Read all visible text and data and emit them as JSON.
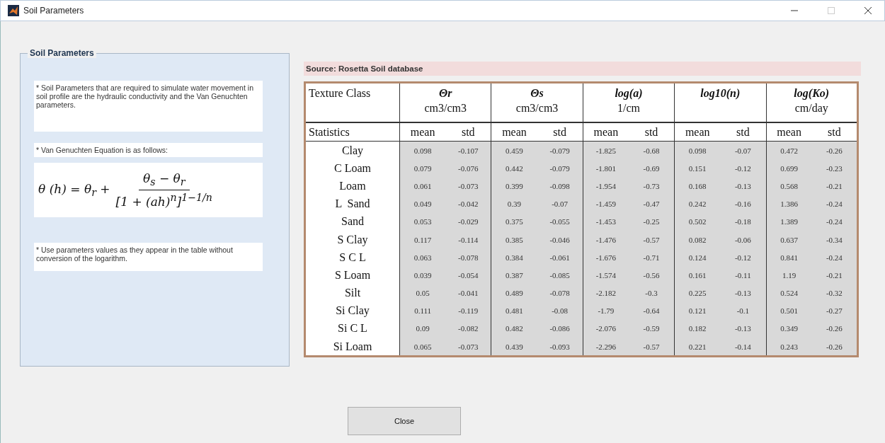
{
  "window": {
    "title": "Soil Parameters"
  },
  "panel": {
    "title": "Soil Parameters",
    "items": [
      {
        "kind": "note",
        "text": "* Soil Parameters that are required to simulate water movement in soil profile are the hydraulic conductivity and the Van Genuchten parameters."
      },
      {
        "kind": "note",
        "text": "* Van Genuchten Equation is as follows:"
      },
      {
        "kind": "equation",
        "lhs": "θ (h) = θ$_{r}$ +",
        "numerator": "θ$_{s}$ − θ$_{r}$",
        "denominator": "[1 + (ah)$^{n}$]$^{1−1/n}$"
      },
      {
        "kind": "note",
        "text": "* Use parameters values as they appear in the table without conversion of the logarithm."
      }
    ]
  },
  "source": "Source: Rosetta Soil database",
  "table": {
    "header": "Texture Class",
    "stats_label": "Statistics",
    "parameters": [
      {
        "name": "Θr",
        "unit": "cm3/cm3",
        "stats": [
          "mean",
          "std"
        ]
      },
      {
        "name": "Θs",
        "unit": "cm3/cm3",
        "stats": [
          "mean",
          "std"
        ]
      },
      {
        "name": "log(a)",
        "unit": "1/cm",
        "stats": [
          "mean",
          "std"
        ]
      },
      {
        "name": "log10(n)",
        "stats": [
          "mean",
          "std"
        ]
      },
      {
        "name": "log(Ko)",
        "unit": "cm/day",
        "stats": [
          "mean",
          "std"
        ]
      }
    ],
    "rows": [
      {
        "texture": "Clay",
        "values": [
          "0.098",
          "-0.107",
          "0.459",
          "-0.079",
          "-1.825",
          "-0.68",
          "0.098",
          "-0.07",
          "0.472",
          "-0.26"
        ]
      },
      {
        "texture": "C Loam",
        "values": [
          "0.079",
          "-0.076",
          "0.442",
          "-0.079",
          "-1.801",
          "-0.69",
          "0.151",
          "-0.12",
          "0.699",
          "-0.23"
        ]
      },
      {
        "texture": "Loam",
        "values": [
          "0.061",
          "-0.073",
          "0.399",
          "-0.098",
          "-1.954",
          "-0.73",
          "0.168",
          "-0.13",
          "0.568",
          "-0.21"
        ]
      },
      {
        "texture": "L  Sand",
        "values": [
          "0.049",
          "-0.042",
          "0.39",
          "-0.07",
          "-1.459",
          "-0.47",
          "0.242",
          "-0.16",
          "1.386",
          "-0.24"
        ]
      },
      {
        "texture": "Sand",
        "values": [
          "0.053",
          "-0.029",
          "0.375",
          "-0.055",
          "-1.453",
          "-0.25",
          "0.502",
          "-0.18",
          "1.389",
          "-0.24"
        ]
      },
      {
        "texture": "S Clay",
        "values": [
          "0.117",
          "-0.114",
          "0.385",
          "-0.046",
          "-1.476",
          "-0.57",
          "0.082",
          "-0.06",
          "0.637",
          "-0.34"
        ]
      },
      {
        "texture": "S C L",
        "values": [
          "0.063",
          "-0.078",
          "0.384",
          "-0.061",
          "-1.676",
          "-0.71",
          "0.124",
          "-0.12",
          "0.841",
          "-0.24"
        ]
      },
      {
        "texture": "S Loam",
        "values": [
          "0.039",
          "-0.054",
          "0.387",
          "-0.085",
          "-1.574",
          "-0.56",
          "0.161",
          "-0.11",
          "1.19",
          "-0.21"
        ]
      },
      {
        "texture": "Silt",
        "values": [
          "0.05",
          "-0.041",
          "0.489",
          "-0.078",
          "-2.182",
          "-0.3",
          "0.225",
          "-0.13",
          "0.524",
          "-0.32"
        ]
      },
      {
        "texture": "Si Clay",
        "values": [
          "0.111",
          "-0.119",
          "0.481",
          "-0.08",
          "-1.79",
          "-0.64",
          "0.121",
          "-0.1",
          "0.501",
          "-0.27"
        ]
      },
      {
        "texture": "Si C L",
        "values": [
          "0.09",
          "-0.082",
          "0.482",
          "-0.086",
          "-2.076",
          "-0.59",
          "0.182",
          "-0.13",
          "0.349",
          "-0.26"
        ]
      },
      {
        "texture": "Si Loam",
        "values": [
          "0.065",
          "-0.073",
          "0.439",
          "-0.093",
          "-2.296",
          "-0.57",
          "0.221",
          "-0.14",
          "0.243",
          "-0.26"
        ]
      }
    ]
  },
  "buttons": [
    {
      "label": "Close"
    }
  ]
}
